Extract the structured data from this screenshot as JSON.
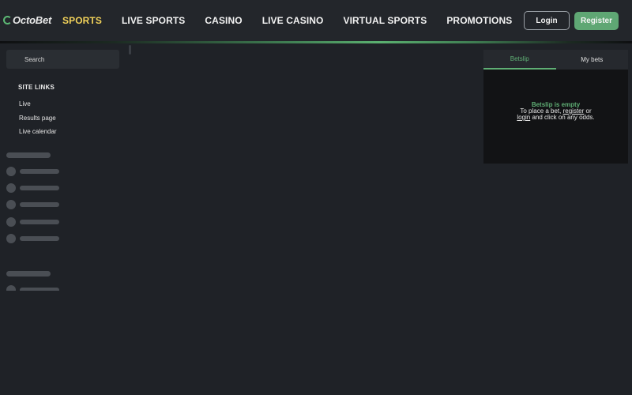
{
  "brand": {
    "name": "OctoBet",
    "accent": "#5fae74"
  },
  "nav": [
    {
      "label": "SPORTS",
      "active": true
    },
    {
      "label": "LIVE SPORTS"
    },
    {
      "label": "CASINO"
    },
    {
      "label": "LIVE CASINO"
    },
    {
      "label": "VIRTUAL SPORTS"
    },
    {
      "label": "PROMOTIONS"
    }
  ],
  "auth": {
    "login": "Login",
    "register": "Register"
  },
  "sidebar": {
    "search_label": "Search",
    "site_links_title": "SITE LINKS",
    "links": [
      "Live",
      "Results page",
      "Live calendar"
    ]
  },
  "betslip": {
    "tabs": [
      "Betslip",
      "My bets"
    ],
    "empty_title": "Betslip is empty",
    "line1_pre": "To place a bet, ",
    "register_link": "register",
    "line1_post": " or",
    "login_link": "login",
    "line2_post": " and click on any odds."
  }
}
